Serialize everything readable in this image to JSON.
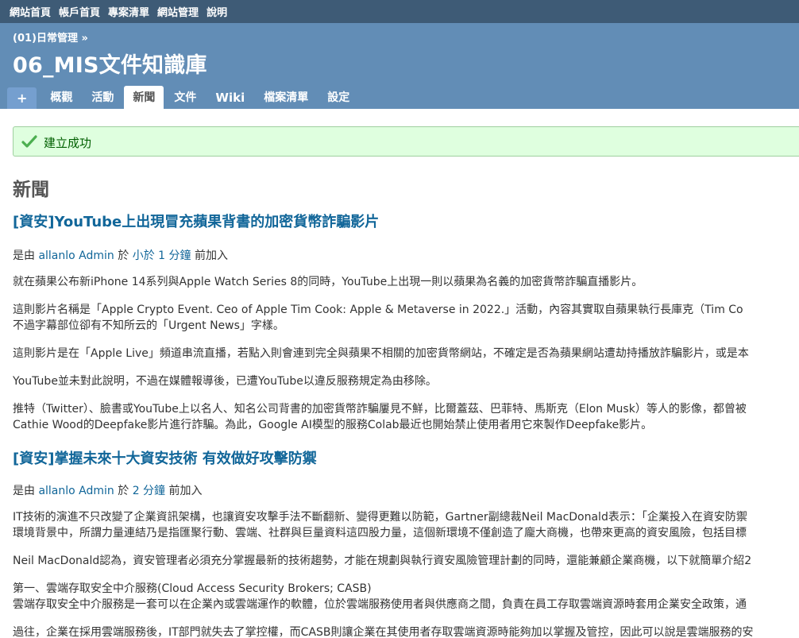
{
  "top_menu": [
    "網站首頁",
    "帳戶首頁",
    "專案清單",
    "網站管理",
    "說明"
  ],
  "header": {
    "breadcrumb": "(01)日常管理 »",
    "title": "06_MIS文件知識庫"
  },
  "tabs": [
    {
      "label": "+",
      "id": "new-object"
    },
    {
      "label": "概觀",
      "id": "overview"
    },
    {
      "label": "活動",
      "id": "activity"
    },
    {
      "label": "新聞",
      "id": "news",
      "selected": true
    },
    {
      "label": "文件",
      "id": "documents"
    },
    {
      "label": "Wiki",
      "id": "wiki"
    },
    {
      "label": "檔案清單",
      "id": "files"
    },
    {
      "label": "設定",
      "id": "settings"
    }
  ],
  "flash": {
    "message": "建立成功"
  },
  "page": {
    "heading": "新聞"
  },
  "news": [
    {
      "title": "[資安]YouTube上出現冒充蘋果背書的加密貨幣詐騙影片",
      "meta": {
        "prefix": "是由",
        "author": "allanlo Admin",
        "mid": "於",
        "time": "小於 1 分鐘",
        "suffix": "前加入"
      },
      "paragraphs": [
        [
          "就在蘋果公布新iPhone 14系列與Apple Watch Series 8的同時，YouTube上出現一則以蘋果為名義的加密貨幣詐騙直播影片。"
        ],
        [
          "這則影片名稱是「Apple Crypto Event. Ceo of Apple Tim Cook: Apple & Metaverse in 2022.」活動，內容其實取自蘋果執行長庫克（Tim Co",
          "不過字幕部位卻有不知所云的「Urgent News」字樣。"
        ],
        [
          "這則影片是在「Apple Live」頻道串流直播，若點入則會連到完全與蘋果不相關的加密貨幣網站，不確定是否為蘋果網站遭劫持播放詐騙影片，或是本"
        ],
        [
          "YouTube並未對此說明，不過在媒體報導後，已遭YouTube以違反服務規定為由移除。"
        ],
        [
          "推特（Twitter）、臉書或YouTube上以名人、知名公司背書的加密貨幣詐騙屢見不鮮，比爾蓋茲、巴菲特、馬斯克（Elon Musk）等人的影像，都曾被",
          "Cathie Wood的Deepfake影片進行詐騙。為此，Google AI模型的服務Colab最近也開始禁止使用者用它來製作Deepfake影片。"
        ]
      ]
    },
    {
      "title": "[資安]掌握未來十大資安技術 有效做好攻擊防禦",
      "meta": {
        "prefix": "是由",
        "author": "allanlo Admin",
        "mid": "於",
        "time": "2 分鐘",
        "suffix": "前加入"
      },
      "paragraphs": [
        [
          "IT技術的演進不只改變了企業資訊架構，也讓資安攻擊手法不斷翻新、變得更難以防範，Gartner副總裁Neil MacDonald表示：「企業投入在資安防禦",
          "環境背景中，所謂力量連結乃是指匯聚行動、雲端、社群與巨量資料這四股力量，這個新環境不僅創造了龐大商機，也帶來更高的資安風險，包括目標"
        ],
        [
          "Neil MacDonald認為，資安管理者必須充分掌握最新的技術趨勢，才能在規劃與執行資安風險管理計劃的同時，還能兼顧企業商機，以下就簡單介紹2"
        ],
        [
          "第一、雲端存取安全中介服務(Cloud Access Security Brokers; CASB)",
          "雲端存取安全中介服務是一套可以在企業內或雲端運作的軟體，位於雲端服務使用者與供應商之間，負責在員工存取雲端資源時套用企業安全政策，通"
        ],
        [
          "過往，企業在採用雲端服務後，IT部門就失去了掌控權，而CASB則讓企業在其使用者存取雲端資源時能夠加以掌握及管控，因此可以說是雲端服務的安"
        ]
      ]
    }
  ],
  "colors": {
    "top_menu_bg": "#3e5b76",
    "header_bg": "#628db6",
    "link": "#116699",
    "flash_bg": "#dfffdf"
  }
}
